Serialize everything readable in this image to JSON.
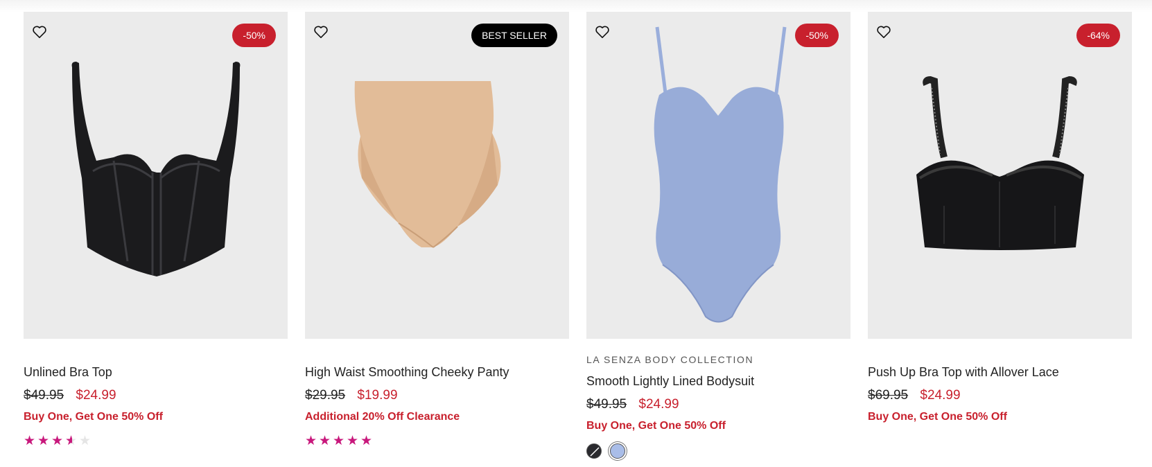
{
  "products": [
    {
      "brand": "",
      "name": "Unlined Bra Top",
      "old_price": "$49.95",
      "new_price": "$24.99",
      "badge": "-50%",
      "badge_type": "sale",
      "promo": "Buy One, Get One 50% Off",
      "rating": 3.5,
      "stars": [
        "full",
        "full",
        "full",
        "half",
        "empty"
      ],
      "image": "black-corset-bra-top"
    },
    {
      "brand": "",
      "name": "High Waist Smoothing Cheeky Panty",
      "old_price": "$29.95",
      "new_price": "$19.99",
      "badge": "BEST SELLER",
      "badge_type": "best",
      "promo": "Additional 20% Off Clearance",
      "rating": 5,
      "stars": [
        "full",
        "full",
        "full",
        "full",
        "full"
      ],
      "image": "nude-high-waist-panty"
    },
    {
      "brand": "LA SENZA BODY COLLECTION",
      "name": "Smooth Lightly Lined Bodysuit",
      "old_price": "$49.95",
      "new_price": "$24.99",
      "badge": "-50%",
      "badge_type": "sale",
      "promo": "Buy One, Get One 50% Off",
      "swatches": [
        {
          "name": "black",
          "color": "#2a2a2e"
        },
        {
          "name": "periwinkle",
          "color": "#a9bde8"
        }
      ],
      "image": "periwinkle-bodysuit"
    },
    {
      "brand": "",
      "name": "Push Up Bra Top with Allover Lace",
      "old_price": "$69.95",
      "new_price": "$24.99",
      "badge": "-64%",
      "badge_type": "sale",
      "promo": "Buy One, Get One 50% Off",
      "image": "black-lace-bra-top"
    }
  ],
  "colors": {
    "sale": "#c8202d",
    "rating_star": "#c8187c",
    "card_bg": "#ebebeb"
  },
  "icons": {
    "wishlist": "heart-outline-icon"
  }
}
